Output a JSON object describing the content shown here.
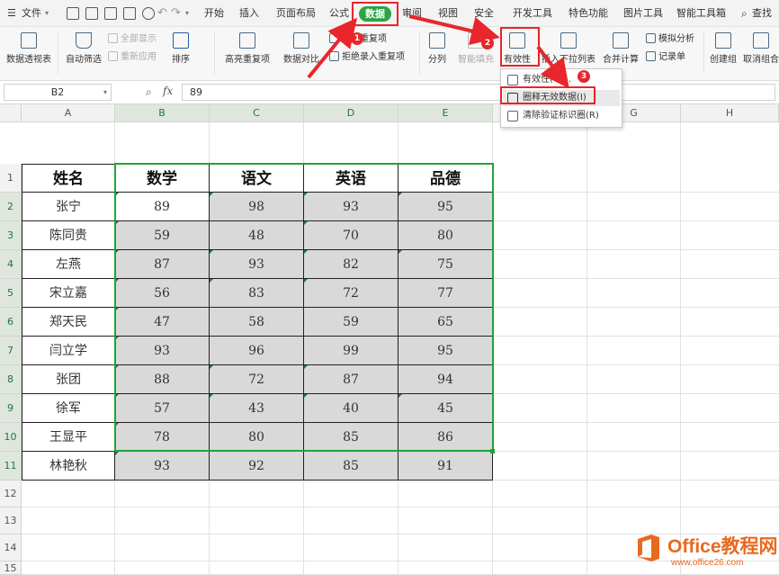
{
  "menubar": {
    "file_label": "文件",
    "tabs": [
      "开始",
      "插入",
      "页面布局",
      "公式",
      "数据",
      "审阅",
      "视图",
      "安全",
      "开发工具",
      "特色功能",
      "图片工具",
      "智能工具箱",
      "查找"
    ]
  },
  "ribbon": {
    "pivot_table": "数据透视表",
    "auto_filter": "自动筛选",
    "show_all": "全部显示",
    "reapply": "重新应用",
    "sort": "排序",
    "highlight_dup": "高亮重复项",
    "data_compare": "数据对比",
    "remove_dup": "删除重复项",
    "reject_dup": "拒绝录入重复项",
    "split": "分列",
    "smart_fill": "智能填充",
    "validity": "有效性",
    "insert_dropdown": "插入下拉列表",
    "merge_calc": "合并计算",
    "simulate": "模拟分析",
    "record": "记录单",
    "create_group": "创建组",
    "ungroup": "取消组合"
  },
  "dropdown": {
    "items": [
      "有效性(V)...",
      "圈释无效数据(I)",
      "清除验证标识圈(R)"
    ]
  },
  "formula_bar": {
    "cell_ref": "B2",
    "fx": "fx",
    "value": "89"
  },
  "columns": [
    "A",
    "B",
    "C",
    "D",
    "E",
    "F",
    "G",
    "H"
  ],
  "rows": [
    "1",
    "2",
    "3",
    "4",
    "5",
    "6",
    "7",
    "8",
    "9",
    "10",
    "11",
    "12",
    "13",
    "14",
    "15"
  ],
  "table": {
    "headers": [
      "姓名",
      "数学",
      "语文",
      "英语",
      "品德"
    ],
    "rows": [
      [
        "张宁",
        "89",
        "98",
        "93",
        "95"
      ],
      [
        "陈同贵",
        "59",
        "48",
        "70",
        "80"
      ],
      [
        "左燕",
        "87",
        "93",
        "82",
        "75"
      ],
      [
        "宋立嘉",
        "56",
        "83",
        "72",
        "77"
      ],
      [
        "郑天民",
        "47",
        "58",
        "59",
        "65"
      ],
      [
        "闫立学",
        "93",
        "96",
        "99",
        "95"
      ],
      [
        "张团",
        "88",
        "72",
        "87",
        "94"
      ],
      [
        "徐军",
        "57",
        "43",
        "40",
        "45"
      ],
      [
        "王显平",
        "78",
        "80",
        "85",
        "86"
      ],
      [
        "林艳秋",
        "93",
        "92",
        "85",
        "91"
      ]
    ]
  },
  "badges": [
    "1",
    "2",
    "3"
  ],
  "watermark": {
    "title": "Office教程网",
    "url": "www.office26.com"
  },
  "colors": {
    "accent_green": "#2ba344",
    "annotation_red": "#e8262b",
    "watermark_orange": "#e86a1f"
  }
}
